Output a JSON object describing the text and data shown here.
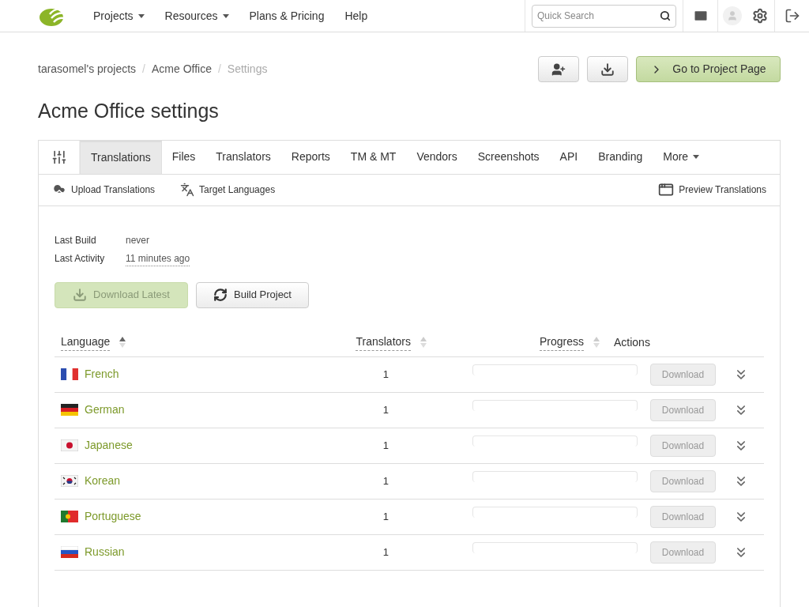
{
  "nav": {
    "menu": [
      {
        "label": "Projects",
        "dropdown": true
      },
      {
        "label": "Resources",
        "dropdown": true
      },
      {
        "label": "Plans & Pricing",
        "dropdown": false
      },
      {
        "label": "Help",
        "dropdown": false
      }
    ],
    "search": {
      "placeholder": "Quick Search"
    }
  },
  "breadcrumb": [
    {
      "label": "tarasomel's projects",
      "current": false
    },
    {
      "label": "Acme Office",
      "current": false
    },
    {
      "label": "Settings",
      "current": true
    }
  ],
  "breadcrumb_separator": "/",
  "go_button": "Go to Project Page",
  "title": "Acme Office settings",
  "tabs": [
    {
      "label": "Translations",
      "selected": true
    },
    {
      "label": "Files",
      "selected": false
    },
    {
      "label": "Translators",
      "selected": false
    },
    {
      "label": "Reports",
      "selected": false
    },
    {
      "label": "TM & MT",
      "selected": false
    },
    {
      "label": "Vendors",
      "selected": false
    },
    {
      "label": "Screenshots",
      "selected": false
    },
    {
      "label": "API",
      "selected": false
    },
    {
      "label": "Branding",
      "selected": false
    }
  ],
  "more_tab": "More",
  "toolbar": {
    "upload": "Upload Translations",
    "targets": "Target Languages",
    "preview": "Preview Translations"
  },
  "info": [
    {
      "label": "Last Build",
      "value": "never",
      "dotted": false
    },
    {
      "label": "Last Activity",
      "value": "11 minutes ago",
      "dotted": true
    }
  ],
  "download_latest": {
    "label": "Download Latest",
    "disabled": true
  },
  "build_button": "Build Project",
  "table": {
    "columns": [
      {
        "label": "Language",
        "sorted": true
      },
      {
        "label": "Translators",
        "sorted": false
      },
      {
        "label": "Progress",
        "sorted": false
      },
      {
        "label": "Actions"
      }
    ],
    "rows": [
      {
        "language": "French",
        "kind": "france",
        "translators": "1",
        "level": 0,
        "download": "Download",
        "disabled": true
      },
      {
        "language": "German",
        "kind": "germany",
        "translators": "1",
        "level": 0,
        "download": "Download",
        "disabled": true
      },
      {
        "language": "Japanese",
        "kind": "japan",
        "translators": "1",
        "level": 0,
        "download": "Download",
        "disabled": true
      },
      {
        "language": "Korean",
        "kind": "korea",
        "translators": "1",
        "level": 0,
        "download": "Download",
        "disabled": true
      },
      {
        "language": "Portuguese",
        "kind": "portugal",
        "translators": "1",
        "level": 0,
        "download": "Download",
        "disabled": true
      },
      {
        "language": "Russian",
        "kind": "russia",
        "translators": "1",
        "level": 0,
        "download": "Download",
        "disabled": true
      }
    ]
  }
}
